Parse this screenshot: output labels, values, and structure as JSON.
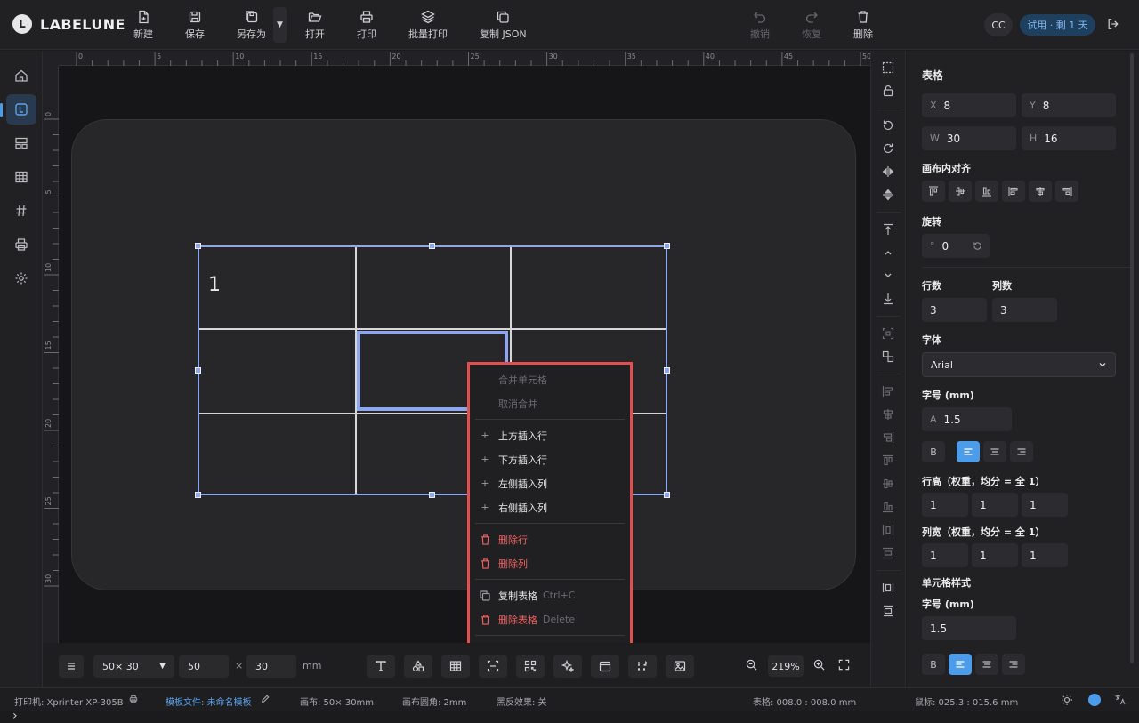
{
  "app": {
    "name": "LABELUNE",
    "logo_letter": "L"
  },
  "toolbar": {
    "new": "新建",
    "save": "保存",
    "save_as": "另存为",
    "open": "打开",
    "print": "打印",
    "batch_print": "批量打印",
    "copy_json": "复制 JSON",
    "undo": "撤销",
    "redo": "恢复",
    "delete": "删除"
  },
  "account": {
    "avatar": "CC",
    "trial": "试用 · 剩 1 天"
  },
  "ruler": {
    "h_ticks": [
      "0",
      "5",
      "10",
      "15",
      "20",
      "25",
      "30",
      "35",
      "40",
      "45",
      "50"
    ],
    "v_ticks": [
      "0",
      "5",
      "10",
      "15",
      "20",
      "25",
      "30"
    ]
  },
  "table": {
    "cell_1_1": "1"
  },
  "context_menu": {
    "merge": "合并单元格",
    "unmerge": "取消合并",
    "insert_above": "上方插入行",
    "insert_below": "下方插入行",
    "insert_left": "左侧插入列",
    "insert_right": "右侧插入列",
    "delete_row": "删除行",
    "delete_col": "删除列",
    "copy_table": "复制表格",
    "copy_shortcut": "Ctrl+C",
    "delete_table": "删除表格",
    "delete_shortcut": "Delete"
  },
  "bottom": {
    "size_preset": "50× 30",
    "width": "50",
    "times": "×",
    "height": "30",
    "unit": "mm",
    "zoom": "219%"
  },
  "props": {
    "title": "表格",
    "x_label": "X",
    "x": "8",
    "y_label": "Y",
    "y": "8",
    "w_label": "W",
    "w": "30",
    "h_label": "H",
    "h": "16",
    "align_title": "画布内对齐",
    "rotate_title": "旋转",
    "rotate_unit": "°",
    "rotate": "0",
    "rows_title": "行数",
    "rows": "3",
    "cols_title": "列数",
    "cols": "3",
    "font_title": "字体",
    "font": "Arial",
    "font_size_title": "字号 (mm)",
    "font_size_label": "A",
    "font_size": "1.5",
    "bold": "B",
    "row_height_title": "行高（权重，均分 = 全 1）",
    "row_heights": [
      "1",
      "1",
      "1"
    ],
    "col_width_title": "列宽（权重，均分 = 全 1）",
    "col_widths": [
      "1",
      "1",
      "1"
    ],
    "cell_style_title": "单元格样式",
    "cell_font_size_title": "字号 (mm)",
    "cell_font_size": "1.5",
    "cell_bold": "B"
  },
  "status": {
    "printer_label": "打印机:",
    "printer": "Xprinter XP-305B",
    "template_label": "模板文件:",
    "template": "未命名模板",
    "canvas": "画布: 50× 30mm",
    "corner": "画布圆角: 2mm",
    "invert": "黑反效果: 关",
    "table_pos": "表格: 008.0 : 008.0 mm",
    "mouse_pos": "鼠标: 025.3 : 015.6 mm"
  },
  "colors": {
    "accent": "#4d9ce9",
    "selection": "#8ea6ee",
    "highlight_border": "#e24f4f",
    "danger": "#f05f5f"
  }
}
